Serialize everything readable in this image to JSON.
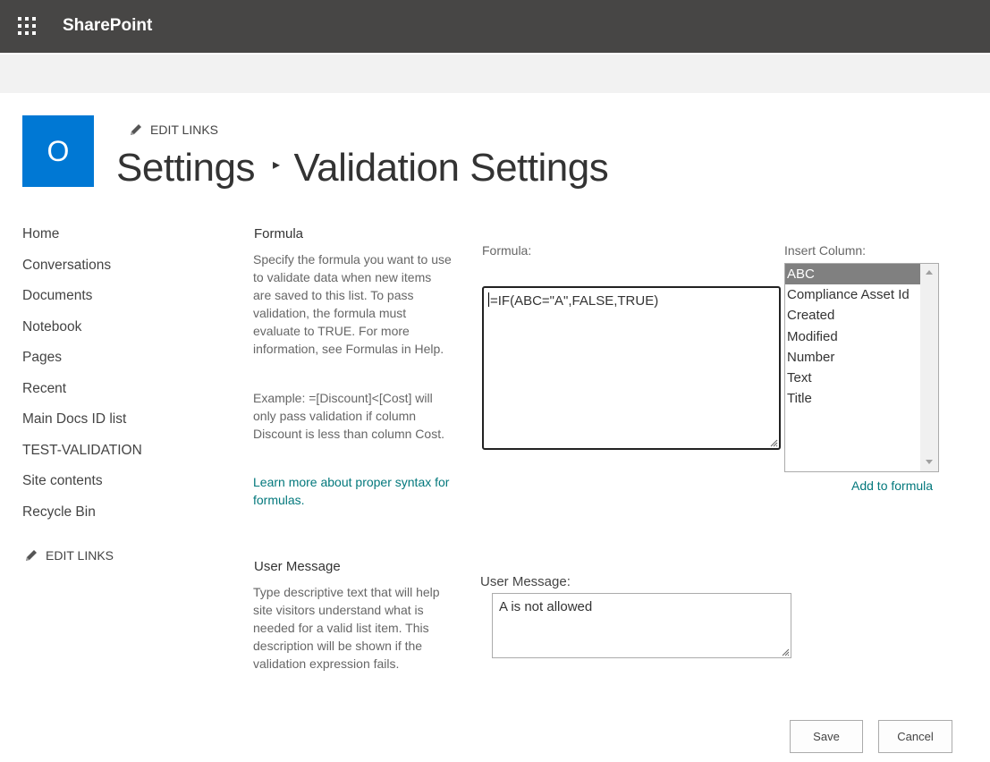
{
  "suitebar": {
    "brand": "SharePoint",
    "waffle_icon": "app-launcher-waffle-icon"
  },
  "site": {
    "logo_letter": "O",
    "logo_color": "#0078d4",
    "edit_links": "EDIT LINKS"
  },
  "title": {
    "parent": "Settings",
    "separator": "▸",
    "current": "Validation Settings"
  },
  "nav": {
    "items": [
      {
        "label": "Home"
      },
      {
        "label": "Conversations"
      },
      {
        "label": "Documents"
      },
      {
        "label": "Notebook"
      },
      {
        "label": "Pages"
      },
      {
        "label": "Recent"
      },
      {
        "label": "Main Docs ID list"
      },
      {
        "label": "TEST-VALIDATION"
      },
      {
        "label": "Site contents"
      },
      {
        "label": "Recycle Bin"
      }
    ],
    "edit_links": "EDIT LINKS"
  },
  "formula_section": {
    "title": "Formula",
    "description": "Specify the formula you want to use to validate data when new items are saved to this list. To pass validation, the formula must evaluate to TRUE. For more information, see Formulas in Help.",
    "example": "Example: =[Discount]<[Cost] will only pass validation if column Discount is less than column Cost.",
    "learn_more": "Learn more about proper syntax for formulas.",
    "field_label": "Formula:",
    "field_value": "=IF(ABC=\"A\",FALSE,TRUE)",
    "insert_column_label": "Insert Column:",
    "columns": [
      {
        "name": "ABC",
        "selected": true
      },
      {
        "name": "Compliance Asset Id",
        "selected": false
      },
      {
        "name": "Created",
        "selected": false
      },
      {
        "name": "Modified",
        "selected": false
      },
      {
        "name": "Number",
        "selected": false
      },
      {
        "name": "Text",
        "selected": false
      },
      {
        "name": "Title",
        "selected": false
      }
    ],
    "add_to_formula": "Add to formula"
  },
  "message_section": {
    "title": "User Message",
    "description": "Type descriptive text that will help site visitors understand what is needed for a valid list item. This description will be shown if the validation expression fails.",
    "field_label": "User Message:",
    "field_value": "A is not allowed"
  },
  "buttons": {
    "save": "Save",
    "cancel": "Cancel"
  },
  "colors": {
    "suitebar": "#474645",
    "link": "#03787c",
    "selected_item": "#808080"
  }
}
